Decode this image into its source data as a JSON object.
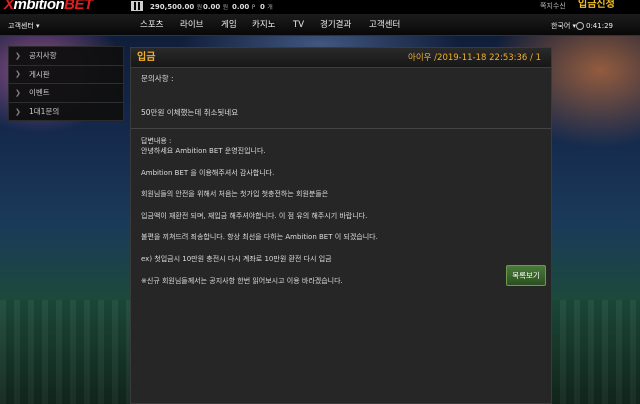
{
  "brand": {
    "logo_prefix": "X",
    "logo_main": "mbition",
    "logo_suffix": "BET"
  },
  "topbar": {
    "balance_1": "290,500.00",
    "balance_1_unit": "원",
    "balance_2": "0.00",
    "balance_2_unit": "원",
    "balance_3": "0.00",
    "balance_3_unit": "P",
    "balance_4": "0",
    "balance_4_unit": "개",
    "link": "쪽지수신",
    "deposit": "입금신청"
  },
  "nav": {
    "cs_select": "고객센터 ▾",
    "items": [
      "스포츠",
      "라이브",
      "게임",
      "카지노",
      "TV",
      "경기결과",
      "고객센터"
    ],
    "language": "한국어 ▾",
    "clock": "0:41:29"
  },
  "sidemenu": {
    "items": [
      "공지사항",
      "게시판",
      "이벤트",
      "1대1문의"
    ]
  },
  "panel": {
    "title": "입금",
    "meta": "아이우 /2019-11-18 22:53:36 / 1",
    "question_label": "문의사항 :",
    "question_text": "50만원 이체했는데 취소됫네요",
    "answer_lines": [
      "답변내용 :",
      "안녕하세요 Ambition BET 운영진입니다.",
      "",
      "Ambition BET 을 이용해주셔서 감사합니다.",
      "",
      "회원님들의 안전을 위해서 처음는 첫가입 첫충전하는 회원분들은",
      "",
      "입금액이 재환전 되며, 재입금 해주셔야합니다. 이 점 유의 해주시기 바랍니다.",
      "",
      "불편을 끼쳐드려 죄송합니다. 항상 최선을 다하는 Ambition BET 이 되겠습니다.",
      "",
      "ex) 첫입금시 10만원 충전시 다시 계좌로 10만원 환전 다시 입금",
      "",
      "※신규 회원님들께서는 공지사항 한번 읽어보시고 이용 바라겠습니다."
    ],
    "list_button": "목록보기"
  }
}
